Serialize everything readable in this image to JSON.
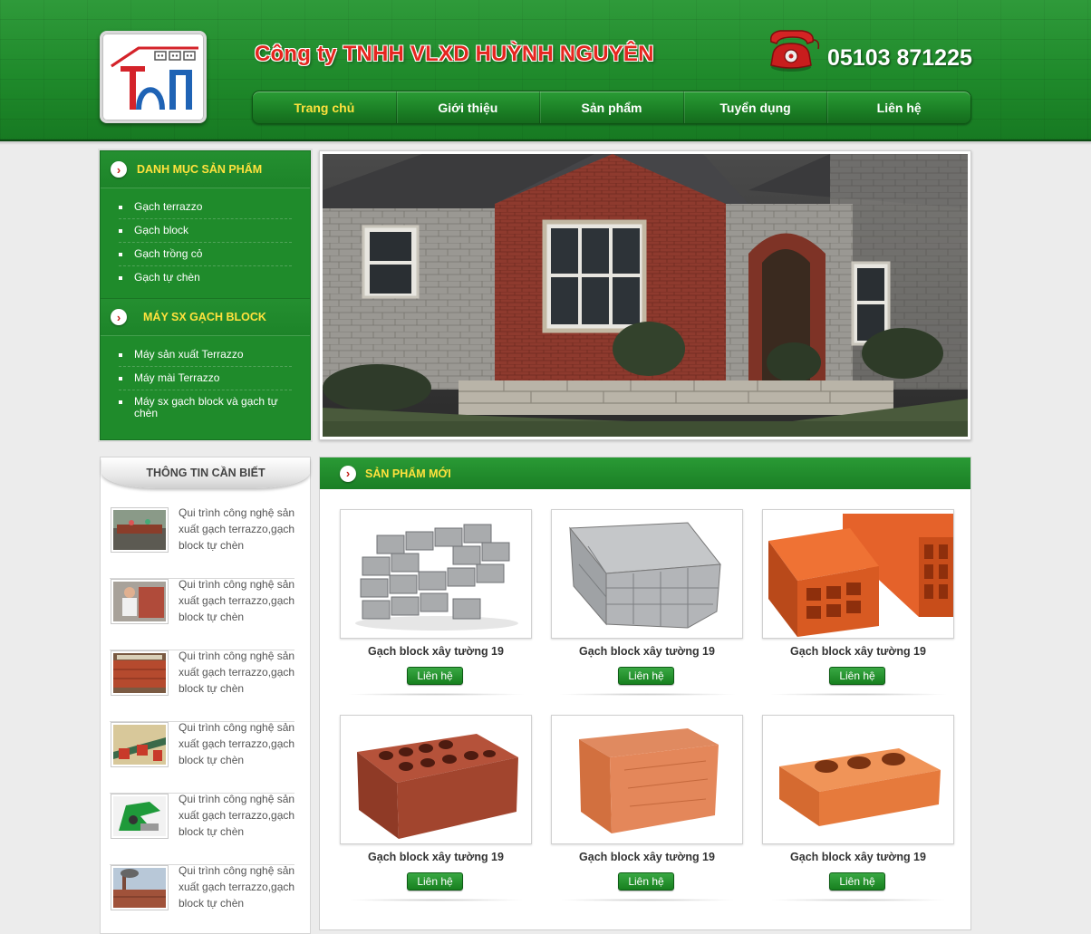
{
  "header": {
    "company_name": "Công ty TNHH VLXD HUỲNH NGUYÊN",
    "phone": "05103 871225"
  },
  "nav": {
    "items": [
      {
        "label": "Trang chủ",
        "active": true
      },
      {
        "label": "Giới thiệu"
      },
      {
        "label": "Sản phẩm"
      },
      {
        "label": "Tuyển dụng"
      },
      {
        "label": "Liên hệ"
      }
    ]
  },
  "sidebar": {
    "categories_title": "DANH MỤC SẢN PHẨM",
    "categories": [
      "Gạch terrazzo",
      "Gạch block",
      "Gạch trồng cỏ",
      "Gạch tự chèn"
    ],
    "machines_title": "MÁY SX GẠCH BLOCK",
    "machines": [
      "Máy sản xuất Terrazzo",
      "Máy mài Terrazzo",
      "Máy sx gạch block và gạch tự chèn"
    ]
  },
  "info": {
    "title": "THÔNG TIN CẦN BIẾT",
    "items": [
      "Qui trình công nghệ sản xuất gạch terrazzo,gạch block tự chèn",
      "Qui trình công nghệ sản xuất gạch terrazzo,gạch block tự chèn",
      "Qui trình công nghệ sản xuất gạch terrazzo,gạch block tự chèn",
      "Qui trình công nghệ sản xuất gạch terrazzo,gạch block tự chèn",
      "Qui trình công nghệ sản xuất gạch terrazzo,gạch block tự chèn",
      "Qui trình công nghệ sản xuất gạch terrazzo,gạch block tự chèn"
    ]
  },
  "products": {
    "title": "SẢN PHẨM MỚI",
    "button_label": "Liên hệ",
    "items": [
      {
        "name": "Gạch block xây tường 19"
      },
      {
        "name": "Gạch block xây tường 19"
      },
      {
        "name": "Gạch block xây tường 19"
      },
      {
        "name": "Gạch block xây tường 19"
      },
      {
        "name": "Gạch block xây tường 19"
      },
      {
        "name": "Gạch block xây tường 19"
      }
    ]
  },
  "colors": {
    "brand_green": "#1f8b2b",
    "accent_yellow": "#ffe23d",
    "title_red": "#e5261f"
  }
}
